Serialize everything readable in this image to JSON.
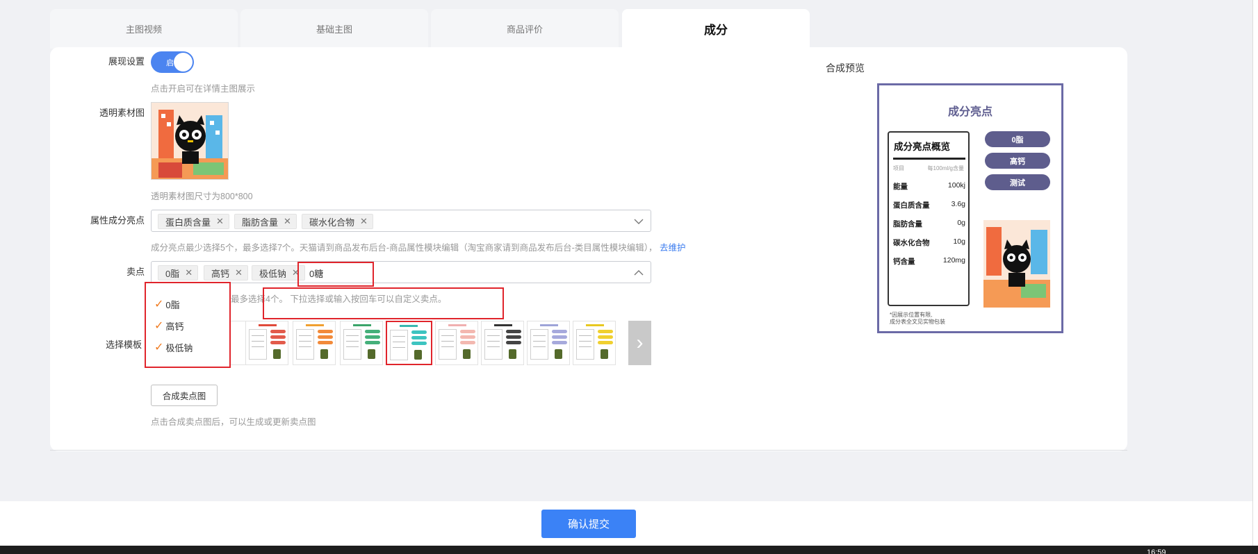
{
  "tabs": [
    "主图视频",
    "基础主图",
    "商品评价",
    "成分"
  ],
  "active_tab": "成分",
  "display_setting": {
    "label": "展现设置",
    "toggle_text": "启",
    "toggle_on": true,
    "hint": "点击开启可在详情主图展示"
  },
  "material": {
    "label": "透明素材图",
    "hint": "透明素材图尺寸为800*800"
  },
  "attributes": {
    "label": "属性成分亮点",
    "tags": [
      "蛋白质含量",
      "脂肪含量",
      "碳水化合物"
    ],
    "hint": "成分亮点最少选择5个，最多选择7个。天猫请到商品发布后台-商品属性模块编辑（淘宝商家请到商品发布后台-类目属性模块编辑），",
    "link": "去维护"
  },
  "selling": {
    "label": "卖点",
    "tags": [
      "0脂",
      "高钙",
      "极低钠"
    ],
    "input_value": "0糖",
    "hint_fragment": "最多选择4个。 下拉选择或输入按回车可以自定义卖点。",
    "options": [
      "0脂",
      "高钙",
      "极低钠"
    ]
  },
  "template": {
    "label": "选择模板",
    "selected_index": 3
  },
  "compose_button": "合成卖点图",
  "compose_hint": "点击合成卖点图后，可以生成或更新卖点图",
  "preview": {
    "label": "合成预览",
    "title": "成分亮点",
    "table_title": "成分亮点概览",
    "col_head_left": "项目",
    "col_head_right": "每100ml/g含量",
    "rows": [
      {
        "k": "能量",
        "v": "100kj"
      },
      {
        "k": "蛋白质含量",
        "v": "3.6g"
      },
      {
        "k": "脂肪含量",
        "v": "0g"
      },
      {
        "k": "碳水化合物",
        "v": "10g"
      },
      {
        "k": "钙含量",
        "v": "120mg"
      }
    ],
    "pills": [
      "0脂",
      "高钙",
      "测试"
    ],
    "note_line1": "*因展示位置有限,",
    "note_line2": "成分表全文见实物包装"
  },
  "submit_button": "确认提交",
  "clock": "16:59",
  "colors": {
    "accent": "#3b82f6",
    "highlight": "#e0242b",
    "preview_purple": "#5e5d8d"
  }
}
